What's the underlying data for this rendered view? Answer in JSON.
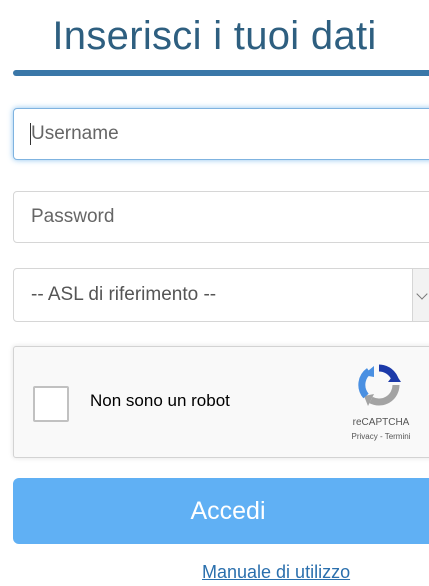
{
  "header": {
    "title": "Inserisci i tuoi dati"
  },
  "form": {
    "username": {
      "placeholder": "Username",
      "value": "",
      "focused": true
    },
    "password": {
      "placeholder": "Password",
      "value": ""
    },
    "asl_select": {
      "selected": "-- ASL di riferimento --",
      "icon": "chevron-down-icon"
    },
    "recaptcha": {
      "checkbox_label": "Non sono un robot",
      "brand": "reCAPTCHA",
      "links": "Privacy - Termini",
      "checked": false,
      "icon": "recaptcha-logo-icon"
    },
    "submit_label": "Accedi"
  },
  "footer": {
    "manual_link": "Manuale di utilizzo"
  },
  "colors": {
    "title": "#2e5f80",
    "title_bar": "#3a77a8",
    "submit_button": "#60b0f4",
    "link": "#2a6fad",
    "focus_ring": "#7fb3e0"
  }
}
